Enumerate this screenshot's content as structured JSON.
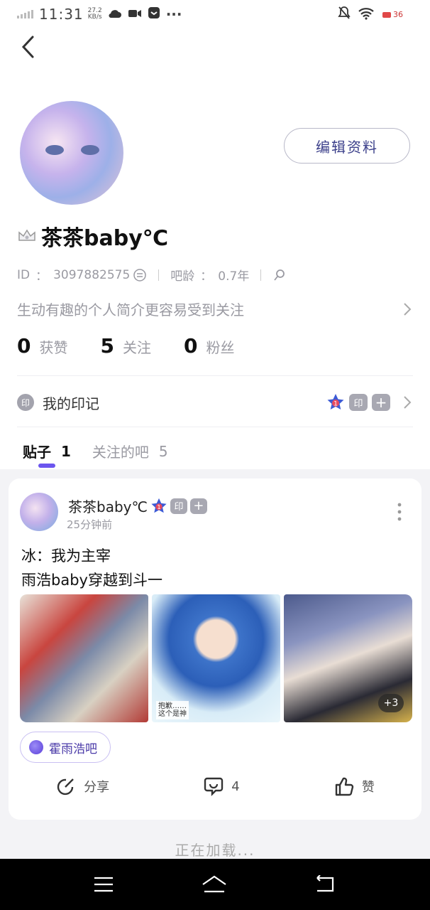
{
  "status": {
    "time": "11:31",
    "speed_value": "27.2",
    "speed_unit": "KB/s",
    "battery": "36"
  },
  "profile": {
    "username": "茶茶baby℃",
    "edit_label": "编辑资料",
    "id_label": "ID",
    "id_value": "3097882575",
    "age_label": "吧龄",
    "age_value": "0.7年",
    "colon": "：",
    "bio_placeholder": "生动有趣的个人简介更容易受到关注"
  },
  "stats": [
    {
      "num": "0",
      "label": "获赞"
    },
    {
      "num": "5",
      "label": "关注"
    },
    {
      "num": "0",
      "label": "粉丝"
    }
  ],
  "mark": {
    "badge": "印",
    "label": "我的印记",
    "chip1": "1",
    "chip2": "印",
    "chip3": "+"
  },
  "tabs": [
    {
      "label": "贴子",
      "count": "1"
    },
    {
      "label": "关注的吧",
      "count": "5"
    }
  ],
  "post": {
    "author": "茶茶baby℃",
    "time": "25分钟前",
    "line1": "冰：我为主宰",
    "line2": "雨浩baby穿越到斗一",
    "img2_caption_1": "抱歉……",
    "img2_caption_2": "这个是神",
    "more_images": "+3",
    "forum": "霍雨浩吧",
    "share_label": "分享",
    "comment_count": "4",
    "like_label": "赞"
  },
  "footer": {
    "loading": "正在加载..."
  },
  "colors": {
    "accent": "#6b55ee",
    "forum_text": "#4a3aa8",
    "edit_text": "#3b3f8a"
  }
}
